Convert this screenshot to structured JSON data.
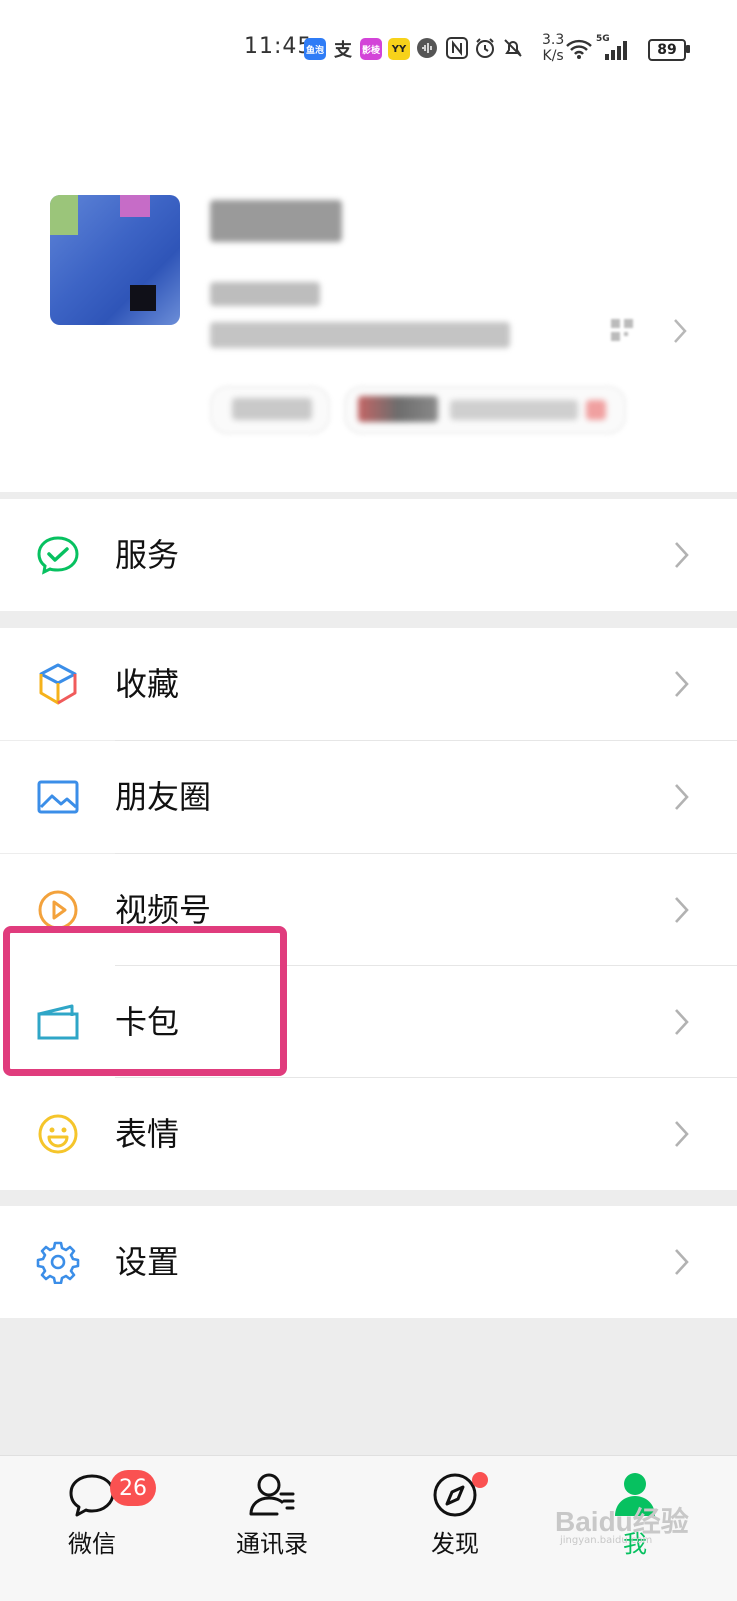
{
  "status_bar": {
    "time": "11:45",
    "app_icons": [
      {
        "name": "fish-app",
        "text": "鱼泡",
        "color": "#2f7cf6"
      },
      {
        "name": "alipay",
        "text": "支",
        "color": "#ffffff"
      },
      {
        "name": "photo-app",
        "text": "影棱",
        "color": "#d344d8"
      },
      {
        "name": "yy-app",
        "text": "YY",
        "color": "#f7d21a"
      }
    ],
    "speed_value": "3.3",
    "speed_unit": "K/s",
    "network": "5G",
    "battery": "89"
  },
  "menu": {
    "service": "服务",
    "favorites": "收藏",
    "moments": "朋友圈",
    "channels": "视频号",
    "card_wallet": "卡包",
    "stickers": "表情",
    "settings": "设置"
  },
  "tabs": {
    "chats": "微信",
    "chats_badge": "26",
    "contacts": "通讯录",
    "discover": "发现",
    "me": "我"
  },
  "watermark": {
    "main": "Baidu经验",
    "sub": "jingyan.baidu.com"
  },
  "colors": {
    "highlight": "#e03c7d",
    "active_tab": "#07c160",
    "badge": "#fa5151"
  }
}
